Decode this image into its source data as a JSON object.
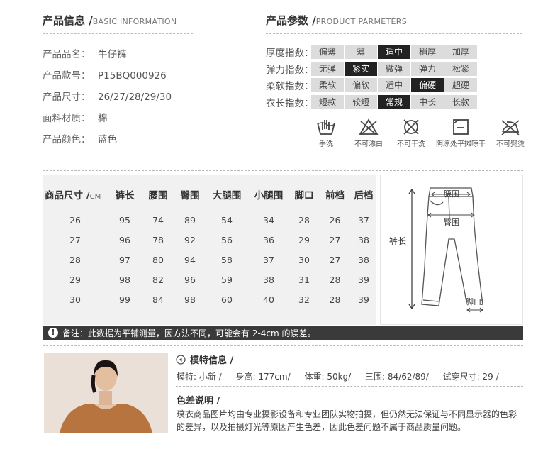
{
  "basic": {
    "title": "产品信息 /",
    "title_en": "BASIC INFORMATION",
    "rows": [
      {
        "label": "产品品名：",
        "value": "牛仔裤"
      },
      {
        "label": "产品款号：",
        "value": "P15BQ000926"
      },
      {
        "label": "产品尺寸：",
        "value": "26/27/28/29/30"
      },
      {
        "label": "面料材质：",
        "value": "棉"
      },
      {
        "label": "产品颜色：",
        "value": "蓝色"
      }
    ]
  },
  "params": {
    "title": "产品参数 /",
    "title_en": "PRODUCT PARMETERS",
    "rows": [
      {
        "label": "厚度指数：",
        "options": [
          "偏薄",
          "薄",
          "适中",
          "稍厚",
          "加厚"
        ],
        "selected": 2
      },
      {
        "label": "弹力指数：",
        "options": [
          "无弹",
          "紧实",
          "微弹",
          "弹力",
          "松紧"
        ],
        "selected": 1
      },
      {
        "label": "柔软指数：",
        "options": [
          "柔软",
          "偏软",
          "适中",
          "偏硬",
          "超硬"
        ],
        "selected": 3
      },
      {
        "label": "衣长指数：",
        "options": [
          "短款",
          "较短",
          "常规",
          "中长",
          "长款"
        ],
        "selected": 2
      }
    ]
  },
  "washing": [
    {
      "icon": "hand-wash-icon",
      "label": "手洗"
    },
    {
      "icon": "no-bleach-icon",
      "label": "不可漂白"
    },
    {
      "icon": "no-dry-clean-icon",
      "label": "不可干洗"
    },
    {
      "icon": "shade-flat-dry-icon",
      "label": "阴凉处平摊晾干"
    },
    {
      "icon": "no-iron-icon",
      "label": "不可熨烫"
    }
  ],
  "size_table": {
    "header_label": "商品尺寸 /",
    "header_unit": "CM",
    "columns": [
      "裤长",
      "腰围",
      "臀围",
      "大腿围",
      "小腿围",
      "脚口",
      "前档",
      "后档"
    ],
    "rows": [
      [
        "26",
        "95",
        "74",
        "89",
        "54",
        "34",
        "28",
        "26",
        "37"
      ],
      [
        "27",
        "96",
        "78",
        "92",
        "56",
        "36",
        "29",
        "27",
        "38"
      ],
      [
        "28",
        "97",
        "80",
        "94",
        "58",
        "37",
        "30",
        "27",
        "38"
      ],
      [
        "29",
        "98",
        "82",
        "96",
        "59",
        "38",
        "31",
        "28",
        "39"
      ],
      [
        "30",
        "99",
        "84",
        "98",
        "60",
        "40",
        "32",
        "28",
        "39"
      ]
    ]
  },
  "diagram": {
    "waist": "腰围",
    "hip": "臀围",
    "length": "裤长",
    "hem": "脚口"
  },
  "note": {
    "icon": "!",
    "text": "备注：此数据为平铺测量，因方法不同，可能会有 2-4cm 的误差。"
  },
  "model": {
    "title": "模特信息 /",
    "info": [
      "模特: 小新 /",
      "身高: 177cm/",
      "体重: 50kg/",
      "三围: 84/62/89/",
      "试穿尺寸: 29 /"
    ]
  },
  "color_note": {
    "title": "色差说明 /",
    "text": "璞衣商品图片均由专业摄影设备和专业团队实物拍摄，但仍然无法保证与不同显示器的色彩的差异，以及拍摄灯光等原因产生色差，因此色差问题不属于商品质量问题。"
  }
}
